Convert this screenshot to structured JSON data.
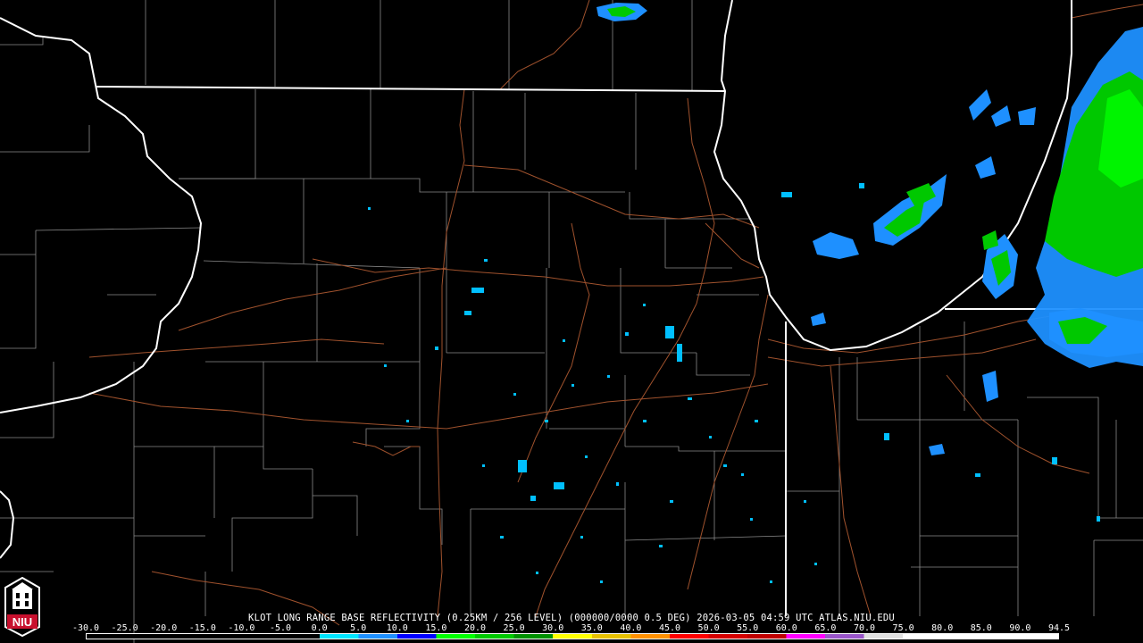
{
  "caption": {
    "text": "KLOT LONG RANGE BASE REFLECTIVITY (0.25KM / 256 LEVEL) (000000/0000 0.5 DEG) 2026-03-05 04:59 UTC  ATLAS.NIU.EDU"
  },
  "logo": {
    "text": "NIU",
    "color": "#c8102e"
  },
  "map_layers": {
    "state_borders_color": "#ffffff",
    "county_lines_color": "#8a8a8a",
    "highways_color": "#a0522d"
  },
  "scale": {
    "labels": [
      "-30.0",
      "-25.0",
      "-20.0",
      "-15.0",
      "-10.0",
      "-5.0",
      "0.0",
      "5.0",
      "10.0",
      "15.0",
      "20.0",
      "25.0",
      "30.0",
      "35.0",
      "40.0",
      "45.0",
      "50.0",
      "55.0",
      "60.0",
      "65.0",
      "70.0",
      "75.0",
      "80.0",
      "85.0",
      "90.0",
      "94.5"
    ],
    "colors": [
      "#000000",
      "#000000",
      "#000000",
      "#000000",
      "#000000",
      "#000000",
      "#00e5ff",
      "#1e90ff",
      "#0000ff",
      "#00ff00",
      "#00c800",
      "#009000",
      "#ffff00",
      "#e7c000",
      "#ff9000",
      "#ff0000",
      "#d60000",
      "#c00000",
      "#ff00ff",
      "#9955c9",
      "#e0e0e0",
      "#ffffff",
      "#ffffff",
      "#ffffff",
      "#ffffff"
    ]
  }
}
